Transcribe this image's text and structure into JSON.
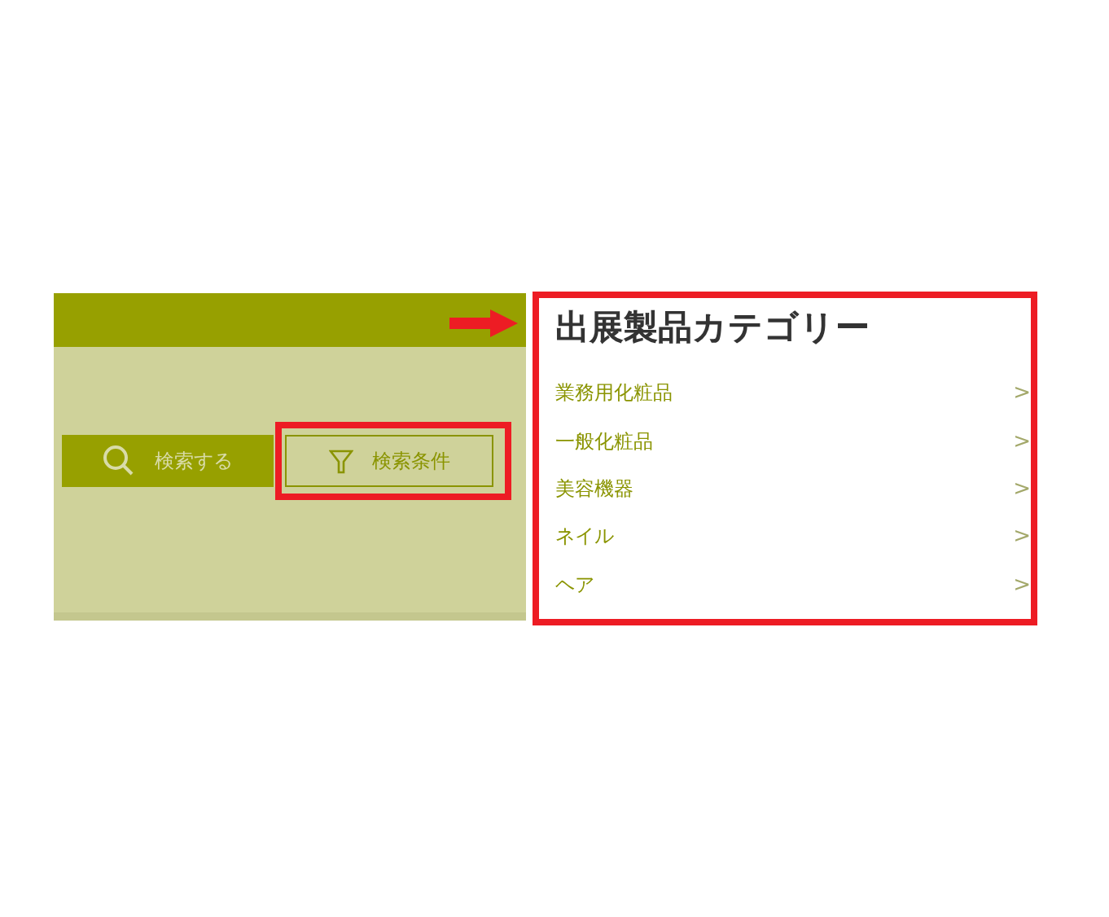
{
  "search_panel": {
    "buttons": [
      {
        "kind": "search",
        "label": "検索する"
      },
      {
        "kind": "filter",
        "label": "検索条件"
      }
    ]
  },
  "category_panel": {
    "title": "出展製品カテゴリー",
    "items": [
      {
        "label": "業務用化粧品",
        "chevron": ">"
      },
      {
        "label": "一般化粧品",
        "chevron": ">"
      },
      {
        "label": "美容機器",
        "chevron": ">"
      },
      {
        "label": "ネイル",
        "chevron": ">"
      },
      {
        "label": "ヘア",
        "chevron": ">"
      }
    ]
  }
}
